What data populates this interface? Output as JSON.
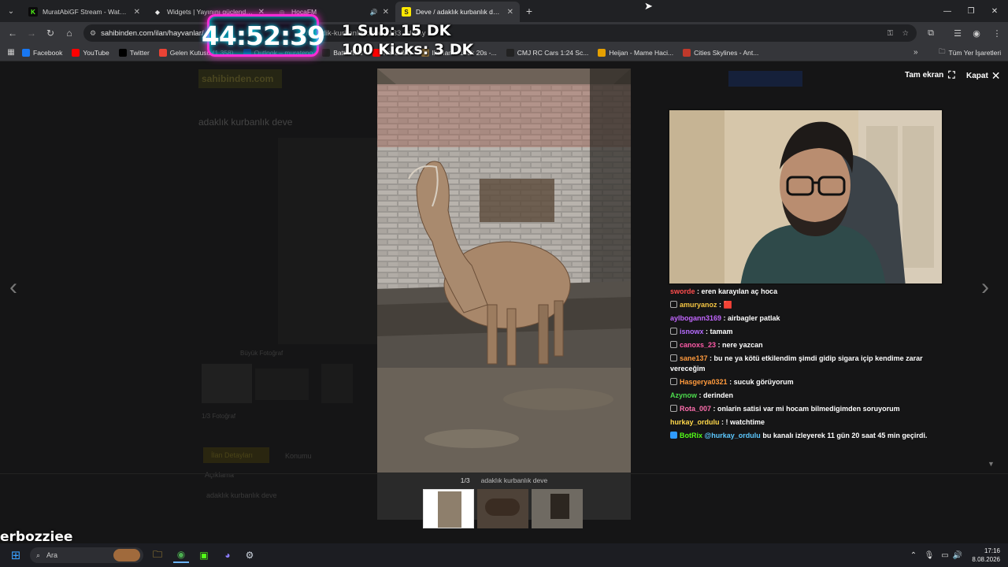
{
  "browser": {
    "tabs": [
      {
        "title": "MuratAbiGF Stream - Watch Li",
        "favicon": "kick-icon",
        "color": "#53fc18",
        "active": false
      },
      {
        "title": "Widgets | Yayınını güçlendirmek",
        "favicon": "widget-icon",
        "color": "#e8e8e8",
        "active": false
      },
      {
        "title": "HocaFM",
        "favicon": "globe-icon",
        "color": "#999999",
        "active": false
      },
      {
        "title": "Deve / adaklık kurbanlık deve s",
        "favicon": "sahibinden-icon",
        "color": "#ffe800",
        "active": true
      }
    ],
    "url": "sahibinden.com/ilan/hayvanlar/",
    "url_tail": "/adaklik-kurbanlik-deve-1133...detay",
    "bookmarks": [
      {
        "label": "Facebook",
        "icon": "facebook-icon",
        "color": "#1877f2"
      },
      {
        "label": "YouTube",
        "icon": "youtube-icon",
        "color": "#ff0000"
      },
      {
        "label": "Twitter",
        "icon": "x-icon",
        "color": "#000000"
      },
      {
        "label": "Gelen Kutusu (1.358)",
        "icon": "gmail-icon",
        "color": "#ea4335"
      },
      {
        "label": "Outlook – murateno",
        "icon": "outlook-icon",
        "color": "#0a64d6"
      },
      {
        "label": "Battlefield",
        "icon": "bl-icon",
        "color": "#222222"
      },
      {
        "label": "Kanaldan",
        "icon": "youtube-icon",
        "color": "#ff0000"
      },
      {
        "label": "Ikariam - 15dk 20s -...",
        "icon": "ikariam-icon",
        "color": "#8a6d3b"
      },
      {
        "label": "CMJ RC Cars 1:24 Sc...",
        "icon": "amazon-icon",
        "color": "#222222"
      },
      {
        "label": "Heijan - Mame Haci...",
        "icon": "heijan-icon",
        "color": "#e5a000"
      },
      {
        "label": "Cities Skylines - Ant...",
        "icon": "cities-icon",
        "color": "#c0392b"
      }
    ],
    "all_bookmarks_label": "Tüm Yer İşaretleri"
  },
  "overlay": {
    "timer": "44:52:39",
    "sub_line": "1 Sub: 15 DK",
    "kick_line": "100 Kicks: 3 DK",
    "streamer_name": "erbozziee"
  },
  "lightbox": {
    "fullscreen_label": "Tam ekran",
    "close_label": "Kapat",
    "counter": "1/3",
    "caption": "adaklık kurbanlık deve"
  },
  "page": {
    "logo": "sahibinden.com",
    "listing_title": "adaklık kurbanlık deve",
    "enlarge_label": "Büyük Fotoğraf",
    "photo_count": "1/3 Fotoğraf",
    "tab_details": "İlan Detayları",
    "tab_location": "Konumu",
    "desc_heading": "Açıklama",
    "desc_text": "adaklık kurbanlık deve"
  },
  "chat": {
    "messages": [
      {
        "user": "sworde",
        "text": "eren karayılan aç hoca",
        "color": "#ff4d4d",
        "badge": ""
      },
      {
        "user": "amuryanoz",
        "text": "🟥",
        "color": "#f5c542",
        "badge": "🤖"
      },
      {
        "user": "aylbogann3169",
        "text": "airbagler patlak",
        "color": "#c266ff",
        "badge": ""
      },
      {
        "user": "isnowx",
        "text": "tamam",
        "color": "#b66cff",
        "badge": "🤖"
      },
      {
        "user": "canoxs_23",
        "text": "nere yazcan",
        "color": "#ff5aa8",
        "badge": "🤖"
      },
      {
        "user": "sane137",
        "text": "bu ne ya kötü etkilendim şimdi gidip sigara içip kendime zarar vereceğim",
        "color": "#ff9a3d",
        "badge": "🤖"
      },
      {
        "user": "Hasgerya0321",
        "text": "sucuk görüyorum",
        "color": "#ff9a3d",
        "badge": "🤖"
      },
      {
        "user": "Azynow",
        "text": "derinden",
        "color": "#4ddb4d",
        "badge": ""
      },
      {
        "user": "Rota_007",
        "text": "onlarin satisi var mi hocam bilmedigimden soruyorum",
        "color": "#ff6fae",
        "badge": "🤖"
      },
      {
        "user": "hurkay_ordulu",
        "text": "! watchtime",
        "color": "#ffd84a",
        "badge": ""
      },
      {
        "user": "BotRix",
        "text": "@hurkay_ordulu bu kanalı izleyerek 11 gün 20 saat 45 min geçirdi.",
        "color": "#53fc18",
        "badge": "✔",
        "mention": "@hurkay_ordulu",
        "mention_color": "#5cc8ff",
        "rest": "bu kanalı izleyerek 11 gün 20 saat 45 min geçirdi."
      }
    ]
  },
  "taskbar": {
    "search_placeholder": "Ara",
    "time": "17:16",
    "date": "8.08.2026"
  }
}
